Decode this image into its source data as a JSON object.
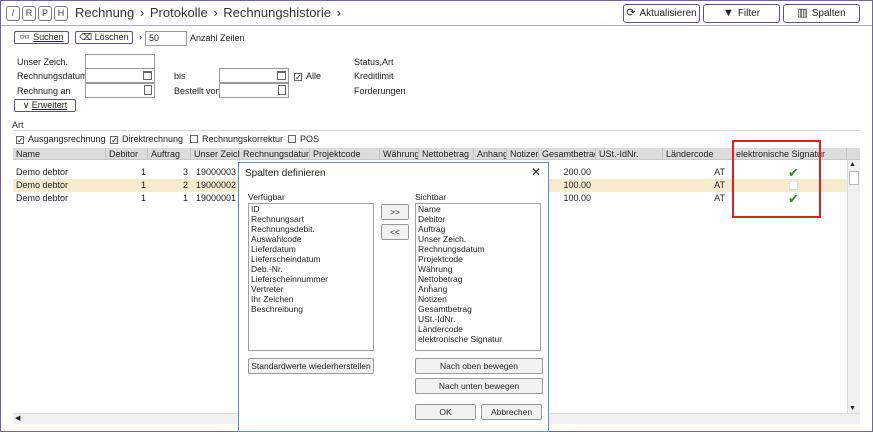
{
  "topbar": {
    "shortcut_buttons": [
      "/",
      "R",
      "P",
      "H"
    ],
    "breadcrumb": [
      "Rechnung",
      "Protokolle",
      "Rechnungshistorie"
    ],
    "refresh_label": "Aktualisieren",
    "filter_label": "Filter",
    "columns_label": "Spalten"
  },
  "search": {
    "search_label": "Suchen",
    "clear_label": "Löschen",
    "rows_value": "50",
    "rows_label": "Anzahl Zeilen"
  },
  "filters": {
    "user_label": "Unser Zeich.",
    "date_label": "Rechnungsdatum",
    "to_label": "bis",
    "all_label": "Alle",
    "invoice_to_label": "Rechnung an",
    "ordered_by_label": "Bestellt von",
    "status_label": "Status,Art",
    "credit_label": "Kreditlimit",
    "claims_label": "Forderungen",
    "extended_label": "Erweitert"
  },
  "art": {
    "title": "Art",
    "options": [
      {
        "label": "Ausgangsrechnung",
        "checked": true
      },
      {
        "label": "Direktrechnung",
        "checked": true
      },
      {
        "label": "Rechnungskorrektur",
        "checked": false
      },
      {
        "label": "POS",
        "checked": false
      }
    ]
  },
  "table": {
    "headers": [
      "Name",
      "Debitor",
      "Auftrag",
      "Unser Zeich.",
      "Rechnungsdatum",
      "Projektcode",
      "Währung",
      "Nettobetrag",
      "Anhang",
      "Notizen",
      "Gesamtbetrag",
      "USt.-IdNr.",
      "Ländercode",
      "elektronische Signatur"
    ],
    "rows": [
      {
        "name": "Demo debtor",
        "debitor": "1",
        "auftrag": "3",
        "nr": "19000003",
        "gesamt": "200.00",
        "land": "AT",
        "signed": true
      },
      {
        "name": "Demo debtor",
        "debitor": "1",
        "auftrag": "2",
        "nr": "19000002",
        "gesamt": "100.00",
        "land": "AT",
        "signed": false
      },
      {
        "name": "Demo debtor",
        "debitor": "1",
        "auftrag": "1",
        "nr": "19000001",
        "gesamt": "100.00",
        "land": "AT",
        "signed": true
      }
    ],
    "tick": "✔"
  },
  "dialog": {
    "title": "Spalten definieren",
    "close": "✕",
    "available_label": "Verfügbar",
    "visible_label": "Sichtbar",
    "available": [
      "ID",
      "Rechnungsart",
      "Rechnungsdebit.",
      "Auswahlcode",
      "Lieferdatum",
      "Lieferscheindatum",
      "Deb.-Nr.",
      "Lieferscheinnummer",
      "Vertreter",
      "Ihr Zeichen",
      "Beschreibung"
    ],
    "visible": [
      "Name",
      "Debitor",
      "Auftrag",
      "Unser Zeich.",
      "Rechnungsdatum",
      "Projektcode",
      "Währung",
      "Nettobetrag",
      "Anhang",
      "Notizen",
      "Gesamtbetrag",
      "USt.-IdNr.",
      "Ländercode",
      "elektronische Signatur"
    ],
    "add_label": ">>",
    "remove_label": "<<",
    "reset_label": "Standardwerte wiederherstellen",
    "move_up_label": "Nach oben bewegen",
    "move_down_label": "Nach unten bewegen",
    "ok_label": "OK",
    "cancel_label": "Abbrechen"
  },
  "colors": {
    "accent": "#5a4ea0",
    "highlight_row": "#f6ebcf",
    "signature_box": "#e02020",
    "tick": "#2a8a1f"
  }
}
